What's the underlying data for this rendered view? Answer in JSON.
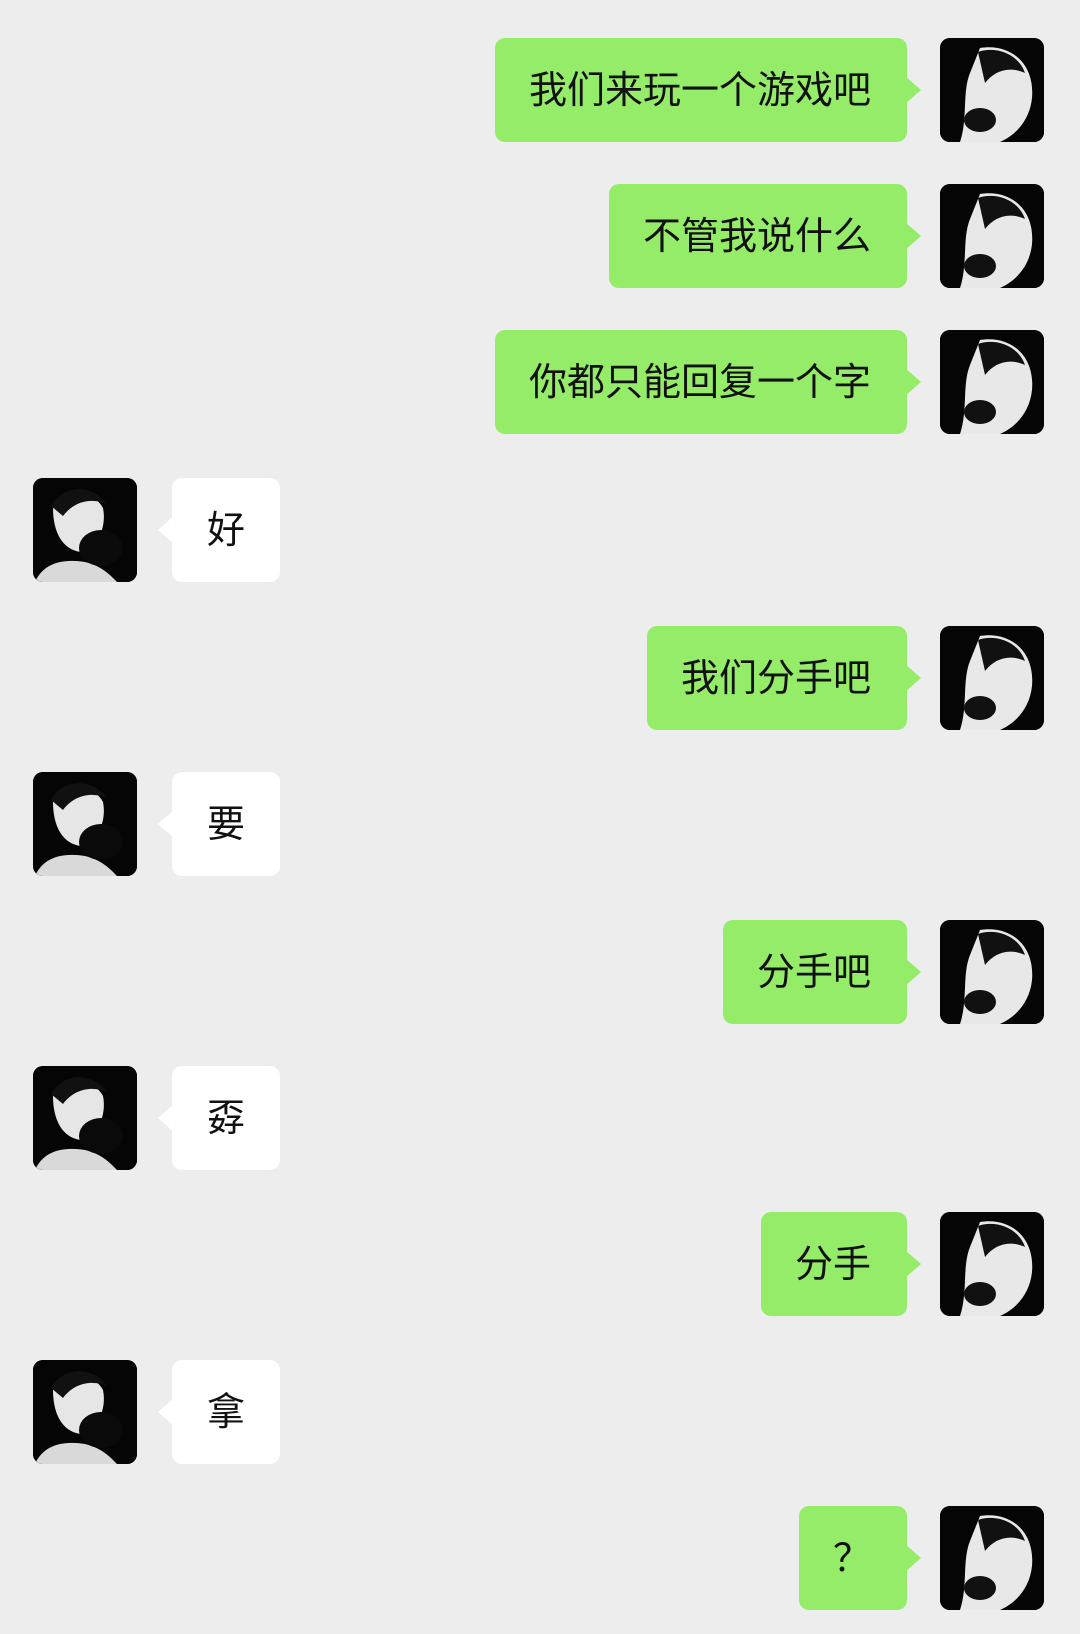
{
  "messages": [
    {
      "side": "out",
      "text": "我们来玩一个游戏吧"
    },
    {
      "side": "out",
      "text": "不管我说什么"
    },
    {
      "side": "out",
      "text": "你都只能回复一个字"
    },
    {
      "side": "in",
      "text": "好"
    },
    {
      "side": "out",
      "text": "我们分手吧"
    },
    {
      "side": "in",
      "text": "要"
    },
    {
      "side": "out",
      "text": "分手吧"
    },
    {
      "side": "in",
      "text": "孬"
    },
    {
      "side": "out",
      "text": "分手"
    },
    {
      "side": "in",
      "text": "拿"
    },
    {
      "side": "out",
      "text": "？"
    }
  ],
  "colors": {
    "background": "#ededed",
    "outgoing_bubble": "#95ec69",
    "incoming_bubble": "#ffffff"
  },
  "icons": {
    "avatar": "avatar-icon"
  }
}
